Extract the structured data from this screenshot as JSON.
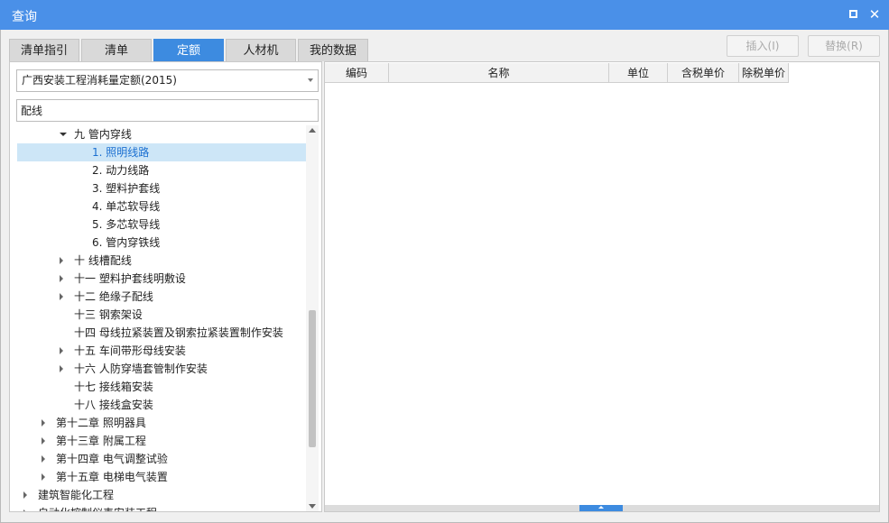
{
  "window": {
    "title": "查询",
    "maximize_icon": "maximize-icon",
    "close_icon": "close-icon"
  },
  "tabs": [
    {
      "label": "清单指引",
      "active": false
    },
    {
      "label": "清单",
      "active": false
    },
    {
      "label": "定额",
      "active": true
    },
    {
      "label": "人材机",
      "active": false
    },
    {
      "label": "我的数据",
      "active": false
    }
  ],
  "actions": {
    "insert": "插入(I)",
    "replace": "替换(R)"
  },
  "quota_select": {
    "value": "广西安装工程消耗量定额(2015)"
  },
  "search": {
    "value": "配线",
    "placeholder": ""
  },
  "tree": [
    {
      "label": "九 管内穿线",
      "state": "expanded"
    },
    {
      "label": "1. 照明线路",
      "state": "leaf",
      "selected": true
    },
    {
      "label": "2. 动力线路",
      "state": "leaf"
    },
    {
      "label": "3. 塑料护套线",
      "state": "leaf"
    },
    {
      "label": "4. 单芯软导线",
      "state": "leaf"
    },
    {
      "label": "5. 多芯软导线",
      "state": "leaf"
    },
    {
      "label": "6. 管内穿铁线",
      "state": "leaf"
    },
    {
      "label": "十 线槽配线",
      "state": "collapsed"
    },
    {
      "label": "十一 塑料护套线明敷设",
      "state": "collapsed"
    },
    {
      "label": "十二 绝缘子配线",
      "state": "collapsed"
    },
    {
      "label": "十三 钢索架设",
      "state": "leaf"
    },
    {
      "label": "十四 母线拉紧装置及钢索拉紧装置制作安装",
      "state": "leaf"
    },
    {
      "label": "十五 车间带形母线安装",
      "state": "collapsed"
    },
    {
      "label": "十六 人防穿墙套管制作安装",
      "state": "collapsed"
    },
    {
      "label": "十七 接线箱安装",
      "state": "leaf"
    },
    {
      "label": "十八 接线盒安装",
      "state": "leaf"
    },
    {
      "label": "第十二章 照明器具",
      "state": "collapsed"
    },
    {
      "label": "第十三章 附属工程",
      "state": "collapsed"
    },
    {
      "label": "第十四章 电气调整试验",
      "state": "collapsed"
    },
    {
      "label": "第十五章 电梯电气装置",
      "state": "collapsed"
    },
    {
      "label": "建筑智能化工程",
      "state": "collapsed"
    },
    {
      "label": "自动化控制仪表安装工程",
      "state": "collapsed"
    }
  ],
  "columns": [
    "编码",
    "名称",
    "单位",
    "含税单价",
    "除税单价"
  ],
  "colors": {
    "titlebar": "#4a90e8",
    "accent": "#3d8be0",
    "selected_bg": "#cde6f7",
    "selected_text": "#1a6fd1"
  }
}
